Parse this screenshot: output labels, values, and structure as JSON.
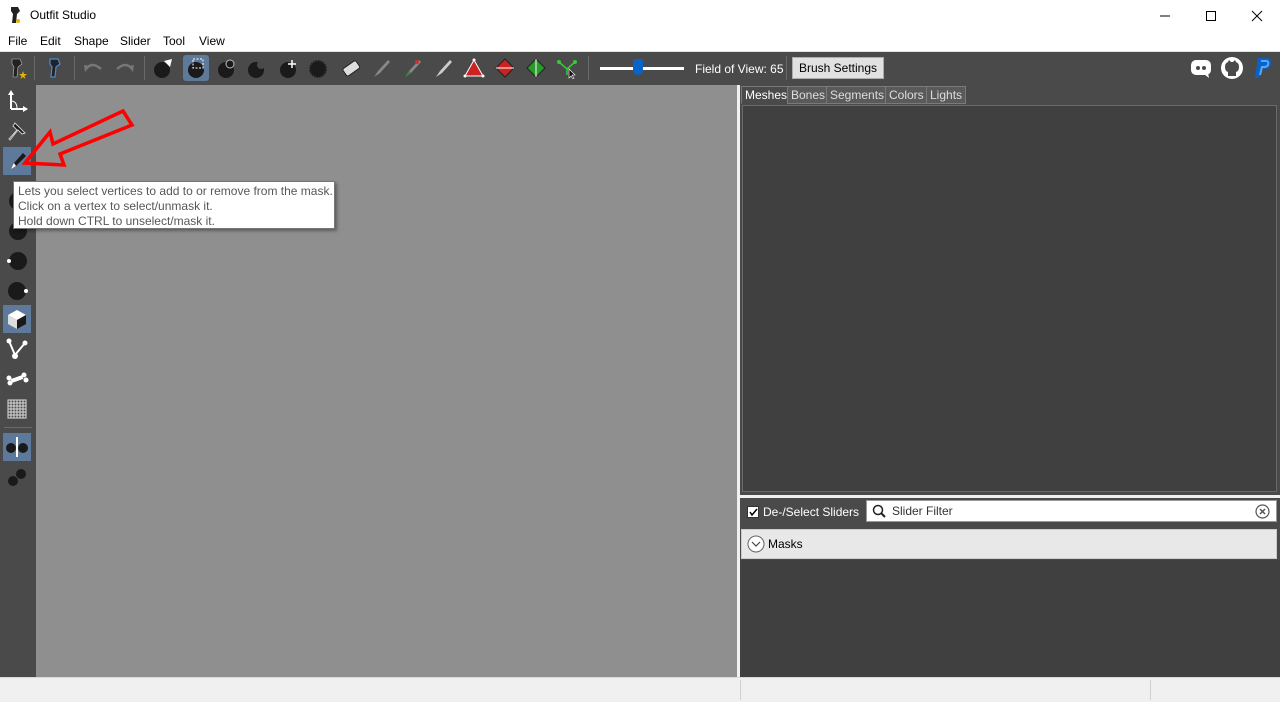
{
  "window": {
    "title": "Outfit Studio"
  },
  "menu": {
    "items": [
      "File",
      "Edit",
      "Shape",
      "Slider",
      "Tool",
      "View"
    ]
  },
  "toolbar": {
    "field_of_view_label": "Field of View: 65",
    "field_of_view_value": 65,
    "brush_settings_label": "Brush Settings",
    "icons": [
      "outfit-icon",
      "reference-icon",
      "undo-icon",
      "redo-icon",
      "select-icon",
      "mask-brush-icon",
      "inflate-icon",
      "deflate-icon",
      "move-icon",
      "smooth-icon",
      "undiff-icon",
      "weight-brush-icon",
      "color-brush-icon",
      "alpha-brush-icon",
      "collapse-vertex-icon",
      "flip-edge-icon",
      "split-edge-icon",
      "select-vertex-icon"
    ]
  },
  "left_tools": [
    "transform-icon",
    "pivot-icon",
    "vertex-select-icon",
    "sphere-icon-1",
    "sphere-icon-2",
    "sphere-icon-3",
    "sphere-icon-4",
    "cube-icon",
    "node-icon",
    "bone-icon",
    "grid-icon",
    "mirror-icon",
    "brush-connected-icon"
  ],
  "tooltip": {
    "lines": [
      "Lets you select vertices to add to or remove from the mask.",
      "Click on a vertex to select/unmask it.",
      "Hold down CTRL to unselect/mask it."
    ]
  },
  "panel": {
    "tabs": [
      "Meshes",
      "Bones",
      "Segments",
      "Colors",
      "Lights"
    ],
    "active_tab": "Meshes",
    "deselect_sliders_label": "De-/Select Sliders",
    "deselect_checked": true,
    "slider_filter_placeholder": "Slider Filter",
    "masks_label": "Masks"
  },
  "colors": {
    "accent": "#5e7a9a",
    "annotation_arrow": "#ff0000"
  }
}
